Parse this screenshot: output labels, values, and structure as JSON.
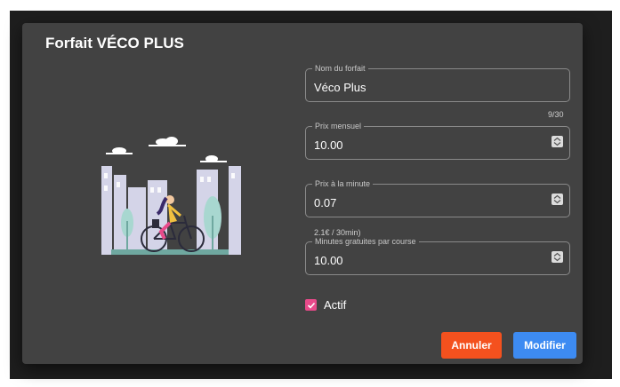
{
  "dialog": {
    "title": "Forfait VÉCO PLUS"
  },
  "form": {
    "name": {
      "label": "Nom du forfait",
      "value": "Véco Plus",
      "counter": "9/30"
    },
    "monthly_price": {
      "label": "Prix mensuel",
      "value": "10.00"
    },
    "price_per_minute": {
      "label": "Prix à la minute",
      "value": "0.07",
      "hint": "2.1€ / 30min)"
    },
    "free_minutes": {
      "label": "Minutes gratuites par course",
      "value": "10.00"
    },
    "active": {
      "label": "Actif",
      "checked": true
    }
  },
  "actions": {
    "cancel_label": "Annuler",
    "save_label": "Modifier"
  },
  "icons": {
    "illustration": "woman-cycling-city-illustration",
    "spinner": "number-spinner-icon",
    "check": "checkmark-icon"
  },
  "colors": {
    "checkbox_accent": "#e84a8a",
    "cancel_button": "#f4511e",
    "save_button": "#3d8bf2",
    "dialog_bg": "#424242"
  }
}
